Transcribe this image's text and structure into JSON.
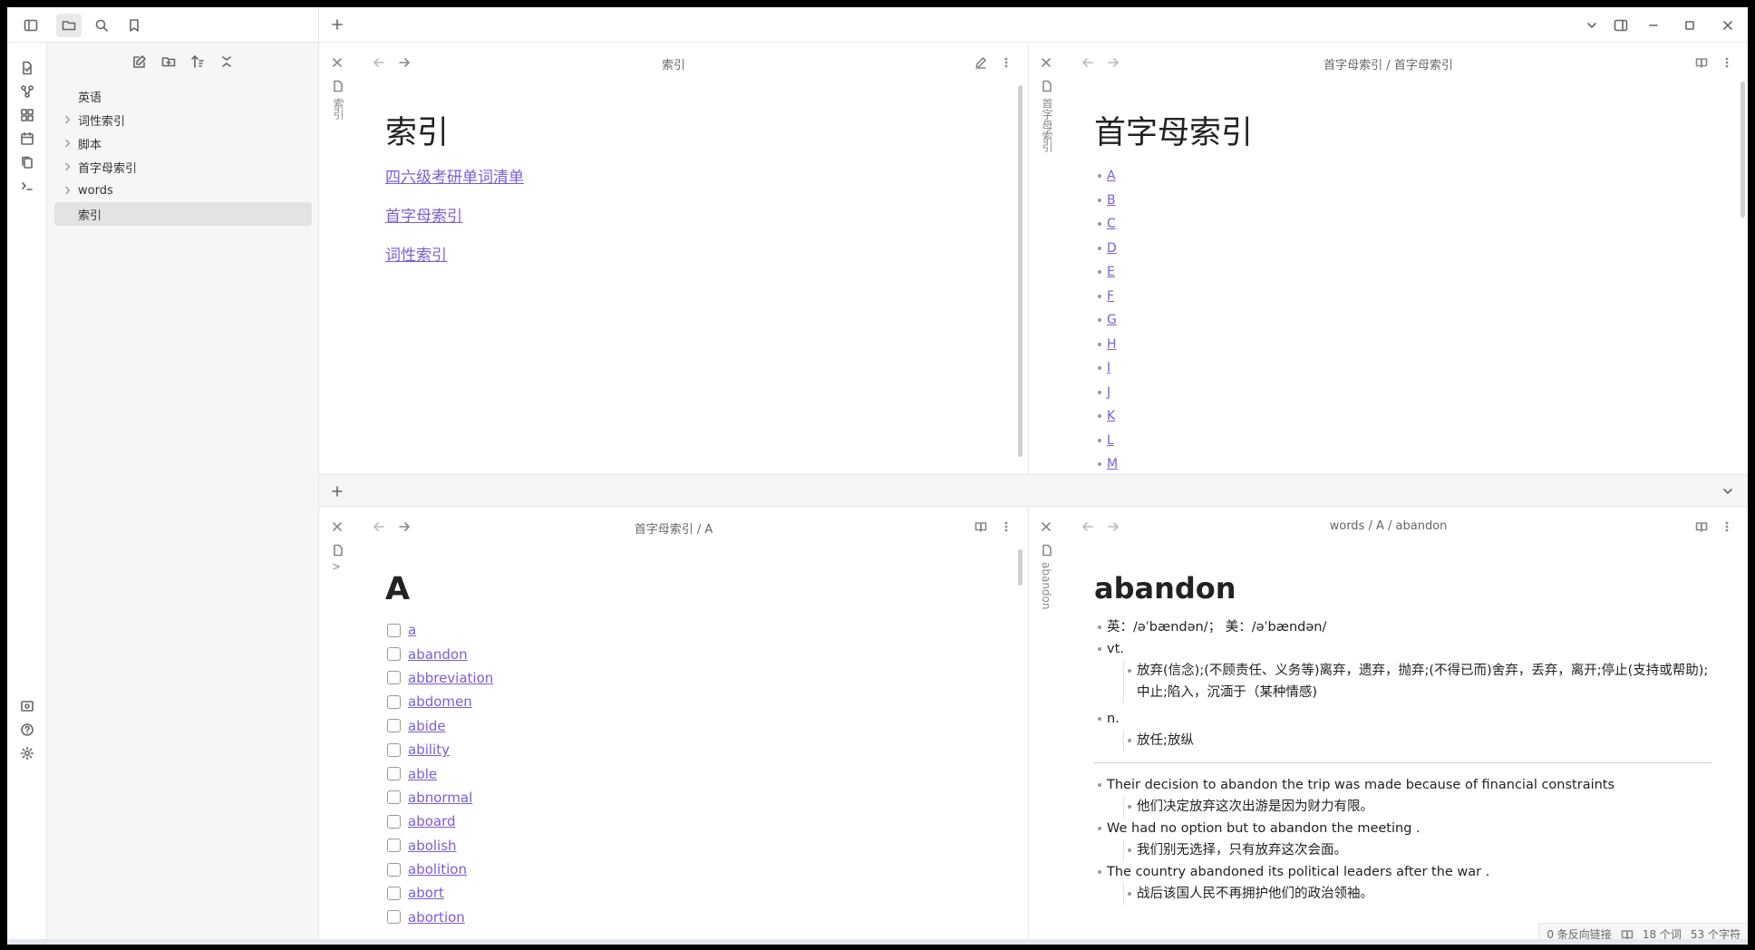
{
  "explorer": {
    "items": [
      {
        "label": "英语",
        "chevron": false
      },
      {
        "label": "词性索引",
        "chevron": true
      },
      {
        "label": "脚本",
        "chevron": true
      },
      {
        "label": "首字母索引",
        "chevron": true
      },
      {
        "label": "words",
        "chevron": true
      },
      {
        "label": "索引",
        "chevron": false,
        "selected": true
      }
    ]
  },
  "pane_index": {
    "header_title": "索引",
    "vertical_title": "索引",
    "heading": "索引",
    "links": [
      "四六级考研单词清单",
      "首字母索引",
      "词性索引"
    ]
  },
  "pane_letters": {
    "header_title": "首字母索引 / 首字母索引",
    "vertical_title": "首字母索引",
    "heading": "首字母索引",
    "letters": [
      "A",
      "B",
      "C",
      "D",
      "E",
      "F",
      "G",
      "H",
      "I",
      "J",
      "K",
      "L",
      "M"
    ]
  },
  "pane_a": {
    "header_title": "首字母索引 / A",
    "vertical_title": ">",
    "heading": "A",
    "words": [
      "a",
      "abandon",
      "abbreviation",
      "abdomen",
      "abide",
      "ability",
      "able",
      "abnormal",
      "aboard",
      "abolish",
      "abolition",
      "abort",
      "abortion"
    ]
  },
  "pane_word": {
    "header_title": "words / A / abandon",
    "vertical_title": "abandon",
    "heading": "abandon",
    "pron": "英：/əˈbændən/； 美：/əˈbændən/",
    "pos1": "vt.",
    "def1": "放弃(信念);(不顾责任、义务等)离弃，遗弃，抛弃;(不得已而)舍弃，丢弃，离开;停止(支持或帮助);中止;陷入，沉湎于（某种情感)",
    "pos2": "n.",
    "def2": "放任;放纵",
    "ex1": "Their decision to abandon the trip was made because of financial constraints",
    "tr1": "他们决定放弃这次出游是因为财力有限。",
    "ex2": "We had no option but to abandon the meeting .",
    "tr2": "我们别无选择，只有放弃这次会面。",
    "ex3": "The country abandoned its political leaders after the war .",
    "tr3": "战后该国人民不再拥护他们的政治领袖。"
  },
  "status": {
    "backlinks": "0 条反向链接",
    "words": "18 个词",
    "chars": "53 个字符"
  },
  "colors": {
    "link": "#7c5cd6",
    "sidebar_bg": "#f6f6f6",
    "selected": "#e3e3e3"
  }
}
